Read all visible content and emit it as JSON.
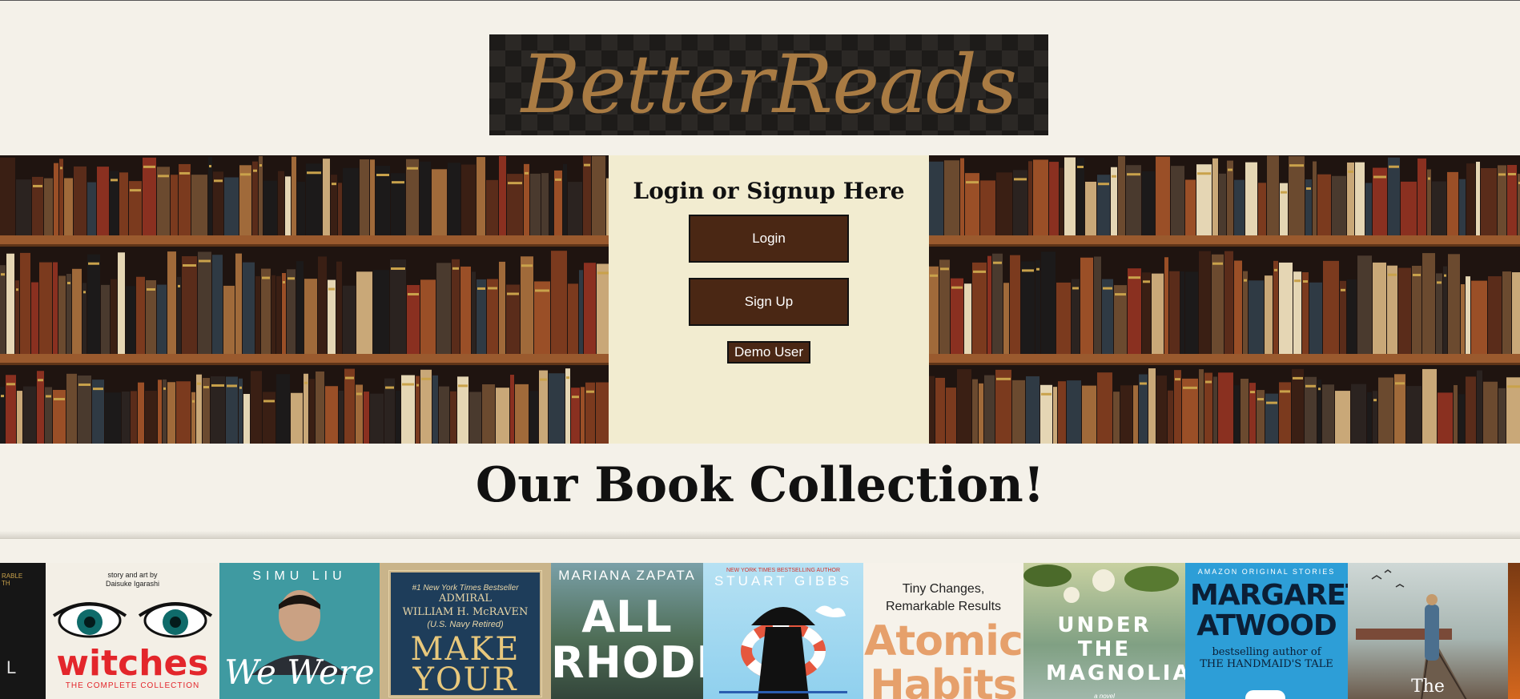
{
  "logo": {
    "text": "BetterReads"
  },
  "auth": {
    "title": "Login or Signup Here",
    "login_label": "Login",
    "signup_label": "Sign Up",
    "demo_label": "Demo User"
  },
  "collection": {
    "title": "Our Book Collection!"
  },
  "books": [
    {
      "author": "",
      "title": "L",
      "tag": "RABLE",
      "sub": "TH"
    },
    {
      "author": "story and art by\nDaisuke Igarashi",
      "title": "witches",
      "tag": "",
      "sub": "THE COMPLETE COLLECTION"
    },
    {
      "author": "SIMU LIU",
      "title": "We Were",
      "tag": "",
      "sub": ""
    },
    {
      "author": "#1 New York Times Bestseller",
      "title": "MAKE YOUR",
      "tag": "ADMIRAL\nWILLIAM H. McRAVEN",
      "sub": "(U.S. Navy Retired)"
    },
    {
      "author": "MARIANA ZAPATA",
      "title": "ALL RHODES",
      "tag": "",
      "sub": ""
    },
    {
      "author": "STUART GIBBS",
      "title": "",
      "tag": "NEW YORK TIMES BESTSELLING AUTHOR",
      "sub": ""
    },
    {
      "author": "",
      "title": "Atomic Habits",
      "tag": "Tiny Changes,\nRemarkable Results",
      "sub": ""
    },
    {
      "author": "",
      "title": "UNDER THE MAGNOLIAS",
      "tag": "",
      "sub": "a novel"
    },
    {
      "author": "MARGARET ATWOOD",
      "title": "",
      "tag": "AMAZON ORIGINAL STORIES",
      "sub": "bestselling author of\nTHE HANDMAID'S TALE"
    },
    {
      "author": "",
      "title": "The",
      "tag": "",
      "sub": ""
    }
  ],
  "colors": {
    "page_bg": "#f4f1e9",
    "button_bg": "#4a2714",
    "auth_panel_bg": "#f2ecd0",
    "logo_gold": "#a97b43"
  }
}
